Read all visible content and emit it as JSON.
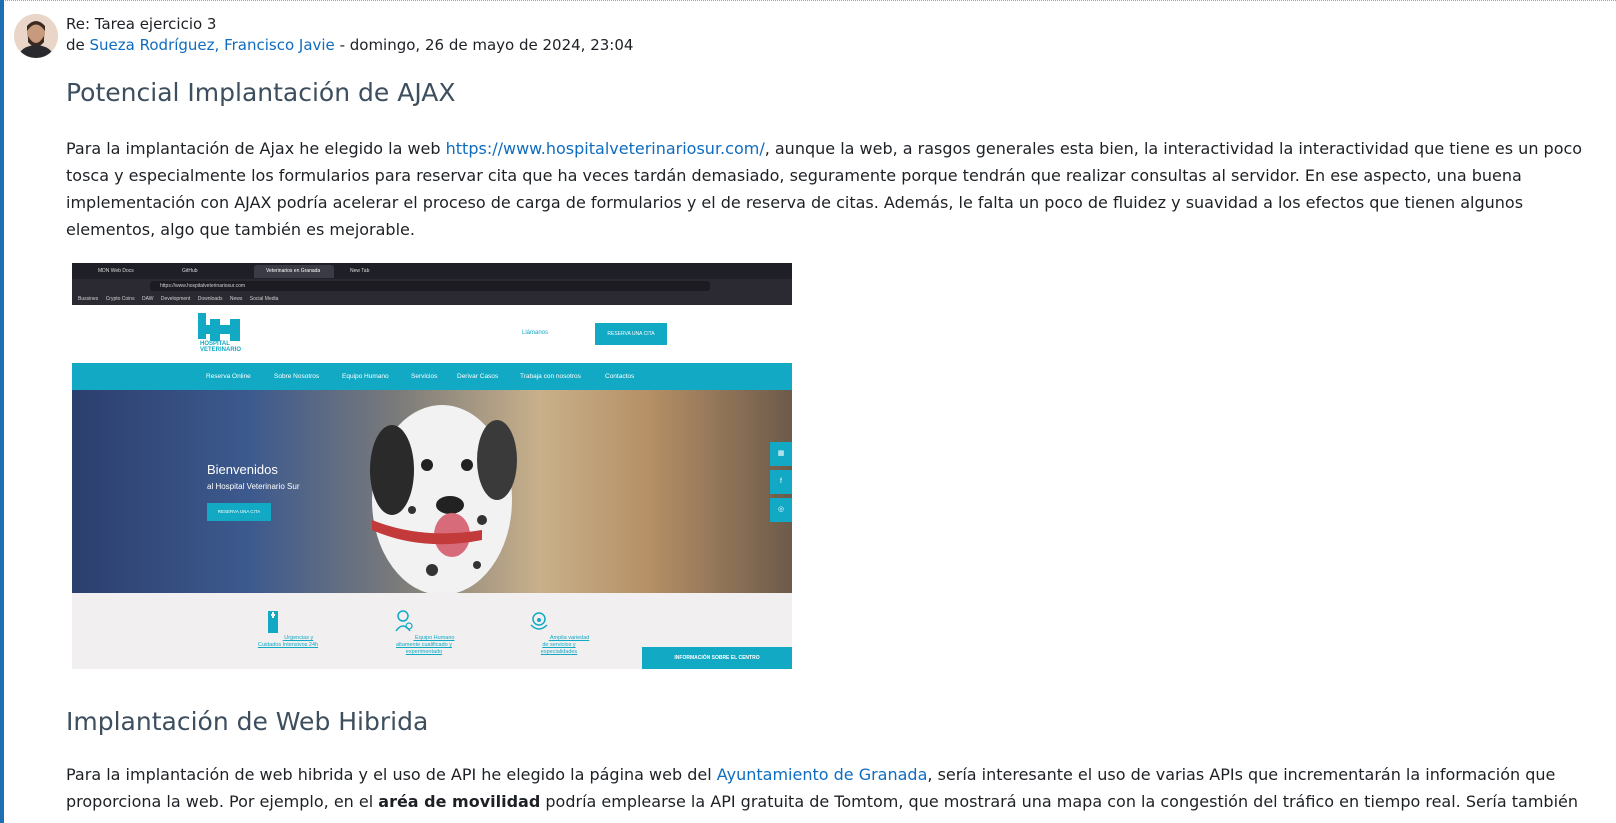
{
  "post": {
    "subject": "Re: Tarea ejercicio 3",
    "by_prefix": "de",
    "author": "Sueza Rodríguez, Francisco Javie",
    "date": " - domingo, 26 de mayo de 2024, 23:04"
  },
  "section1": {
    "heading": "Potencial Implantación de AJAX",
    "text_before_link": "Para la implantación de Ajax he elegido la web ",
    "link": "https://www.hospitalveterinariosur.com/",
    "text_after_link": ", aunque la web, a rasgos generales esta bien, la interactividad la interactividad que tiene es un poco tosca y especialmente los formularios para reservar cita que ha veces tardán demasiado, seguramente porque tendrán que realizar consultas al servidor. En ese aspecto, una buena implementación con AJAX podría acelerar el proceso de carga de formularios y el de reserva de citas. Además, le falta un poco de fluidez y suavidad a los efectos que tienen algunos elementos, algo que también es mejorable."
  },
  "screenshot": {
    "tabs": [
      "MDN Web Docs",
      "GitHub",
      "Veterinarios en Granada",
      "New Tab"
    ],
    "url": "https://www.hospitalveterinariosur.com",
    "bookmarks": [
      "Bussines",
      "Crypto Coins",
      "DAW",
      "Development",
      "Downloads",
      "News",
      "Social Media"
    ],
    "logo_text": "HOSPITAL VETERINARIO",
    "llamanos": "Llámanos",
    "reserva_cita": "RESERVA UNA CITA",
    "nav": [
      "Reserva Online",
      "Sobre Nosotros",
      "Equipo Humano",
      "Servicios",
      "Derivar Casos",
      "Trabaja con nosotros",
      "Contactos"
    ],
    "hero_title": "Bienvenidos",
    "hero_sub": "al Hospital Veterinario Sur",
    "hero_btn": "RESERVA UNA CITA",
    "features": [
      "Urgencias y Cuidados Intensivos 24h",
      "Equipo Humano altamente cualificado y experimentado",
      "Amplia variedad de servicios y especialidades"
    ],
    "info_btn": "INFORMACIÓN SOBRE EL CENTRO"
  },
  "section2": {
    "heading": "Implantación de Web Hibrida",
    "text_before_link": "Para la implantación de web hibrida y el uso de API he elegido la página web del ",
    "link": "Ayuntamiento de Granada",
    "text_after_link": ", sería interesante el uso de varias APIs que incrementarán la información que proporciona la web. Por ejemplo, en el ",
    "bold": "aréa de movilidad",
    "text_end": " podría emplearse la API gratuita de Tomtom, que mostrará una mapa con la congestión del tráfico en tiempo real. Sería también"
  },
  "colors": {
    "accent": "#0f6cbf",
    "site_teal": "#11a9c4",
    "left_bar": "#1f6fb5"
  }
}
